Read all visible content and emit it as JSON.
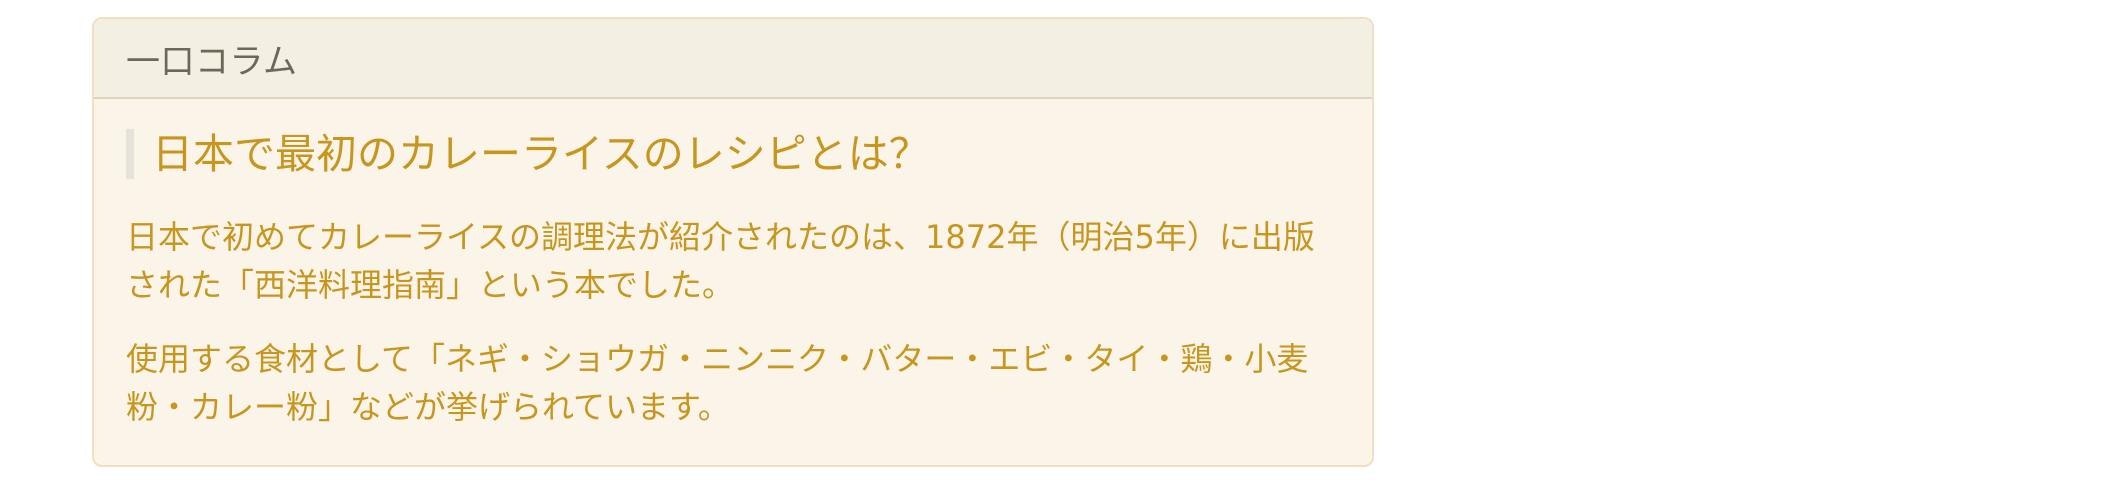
{
  "panel": {
    "heading": "一口コラム",
    "subheading": "日本で最初のカレーライスのレシピとは？",
    "paragraphs": [
      "日本で初めてカレーライスの調理法が紹介されたのは、1872年（明治5年）に出版された「西洋料理指南」という本でした。",
      "使用する食材として「ネギ・ショウガ・ニンニク・バター・エビ・タイ・鶏・小麦粉・カレー粉」などが挙げられています。"
    ]
  },
  "colors": {
    "panel_background": "#fbf4e9",
    "heading_background": "#f3efe3",
    "text_gold": "#c7961f",
    "border": "#efe0c2"
  }
}
